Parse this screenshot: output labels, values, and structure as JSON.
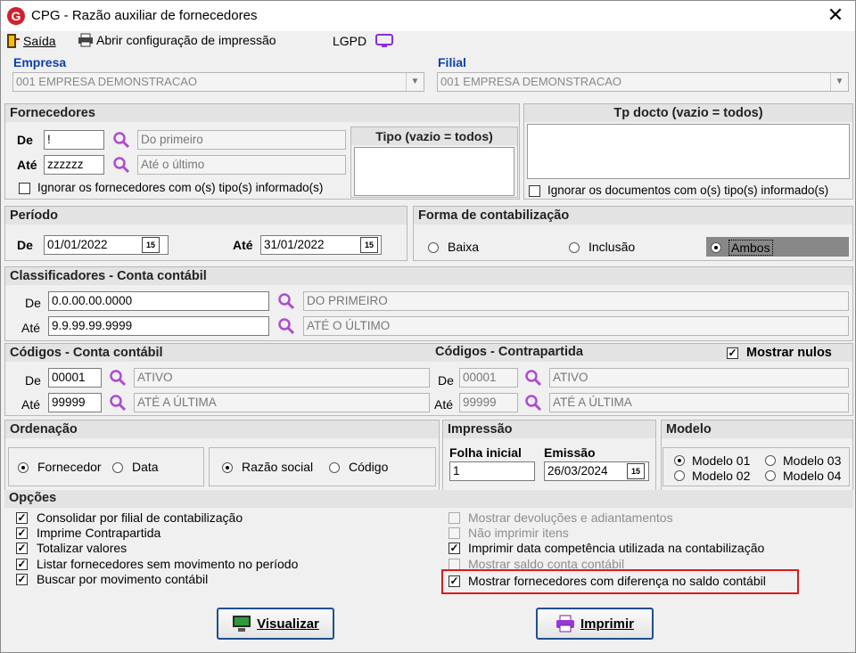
{
  "window": {
    "title": "CPG - Razão auxiliar de fornecedores",
    "logo": "G",
    "close": "✕"
  },
  "menu": {
    "exit": "Saída",
    "print_config": "Abrir configuração de impressão",
    "lgpd": "LGPD"
  },
  "empresa": {
    "label": "Empresa",
    "value": "001 EMPRESA DEMONSTRACAO"
  },
  "filial": {
    "label": "Filial",
    "value": "001 EMPRESA DEMONSTRACAO"
  },
  "fornecedores": {
    "title": "Fornecedores",
    "de_label": "De",
    "de_value": "!",
    "de_desc": "Do primeiro",
    "ate_label": "Até",
    "ate_value": "zzzzzz",
    "ate_desc": "Até o último",
    "ignore_label": "Ignorar os fornecedores com o(s) tipo(s) informado(s)",
    "tipo_title": "Tipo (vazio = todos)"
  },
  "tpdocto": {
    "title": "Tp docto (vazio = todos)",
    "ignore_label": "Ignorar os documentos com o(s) tipo(s) informado(s)"
  },
  "periodo": {
    "title": "Período",
    "de_label": "De",
    "de_value": "01/01/2022",
    "ate_label": "Até",
    "ate_value": "31/01/2022",
    "cal": "15"
  },
  "forma": {
    "title": "Forma de contabilização",
    "options": [
      "Baixa",
      "Inclusão",
      "Ambos"
    ],
    "selected": "Ambos"
  },
  "classificadores": {
    "title": "Classificadores - Conta contábil",
    "de_label": "De",
    "de_value": "0.0.00.00.0000",
    "de_desc": "DO PRIMEIRO",
    "ate_label": "Até",
    "ate_value": "9.9.99.99.9999",
    "ate_desc": "ATÉ O ÚLTIMO"
  },
  "codigos_conta": {
    "title": "Códigos - Conta contábil",
    "de_label": "De",
    "de_value": "00001",
    "de_desc": "ATIVO",
    "ate_label": "Até",
    "ate_value": "99999",
    "ate_desc": "ATÉ A ÚLTIMA"
  },
  "codigos_contra": {
    "title": "Códigos - Contrapartida",
    "de_label": "De",
    "de_value": "00001",
    "de_desc": "ATIVO",
    "ate_label": "Até",
    "ate_value": "99999",
    "ate_desc": "ATÉ A ÚLTIMA",
    "mostrar_nulos": "Mostrar nulos"
  },
  "ordenacao": {
    "title": "Ordenação",
    "group1": [
      "Fornecedor",
      "Data"
    ],
    "group2": [
      "Razão social",
      "Código"
    ]
  },
  "impressao": {
    "title": "Impressão",
    "folha_label": "Folha inicial",
    "folha_value": "1",
    "emissao_label": "Emissão",
    "emissao_value": "26/03/2024"
  },
  "modelo": {
    "title": "Modelo",
    "options": [
      "Modelo 01",
      "Modelo 03",
      "Modelo 02",
      "Modelo 04"
    ]
  },
  "opcoes": {
    "title": "Opções",
    "left": [
      "Consolidar por filial de contabilização",
      "Imprime Contrapartida",
      "Totalizar valores",
      "Listar fornecedores sem movimento no período",
      "Buscar por movimento contábil"
    ],
    "right": [
      "Mostrar devoluções e adiantamentos",
      "Não imprimir itens",
      "Imprimir data competência utilizada na contabilização",
      "Mostrar saldo conta contábil",
      "Mostrar fornecedores com diferença no saldo contábil"
    ]
  },
  "buttons": {
    "visualizar": "Visualizar",
    "imprimir": "Imprimir"
  }
}
